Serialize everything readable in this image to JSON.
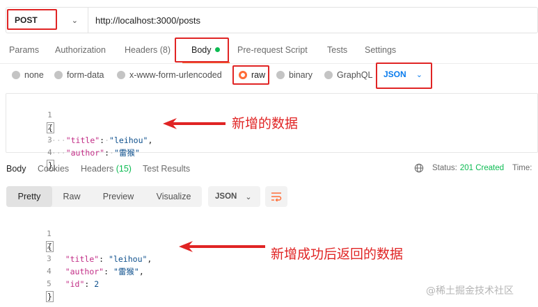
{
  "request": {
    "method": "POST",
    "url": "http://localhost:3000/posts",
    "tabs": [
      {
        "label": "Params"
      },
      {
        "label": "Authorization"
      },
      {
        "label": "Headers (8)"
      },
      {
        "label": "Body"
      },
      {
        "label": "Pre-request Script"
      },
      {
        "label": "Tests"
      },
      {
        "label": "Settings"
      }
    ],
    "active_tab": "Body",
    "body_types": [
      {
        "label": "none"
      },
      {
        "label": "form-data"
      },
      {
        "label": "x-www-form-urlencoded"
      },
      {
        "label": "raw"
      },
      {
        "label": "binary"
      },
      {
        "label": "GraphQL"
      }
    ],
    "selected_body_type": "raw",
    "format": "JSON",
    "body_lines": [
      {
        "num": "1",
        "text": "{"
      },
      {
        "num": "2",
        "key": "\"title\"",
        "value": "\"leihou\""
      },
      {
        "num": "3",
        "key": "\"author\"",
        "value": "\"雷猴\""
      },
      {
        "num": "4",
        "text": "}"
      }
    ]
  },
  "response": {
    "tabs": [
      {
        "label": "Body"
      },
      {
        "label": "Cookies"
      },
      {
        "label": "Headers",
        "count": "(15)"
      },
      {
        "label": "Test Results"
      }
    ],
    "status_label": "Status:",
    "status_value": "201 Created",
    "time_label": "Time:",
    "views": [
      "Pretty",
      "Raw",
      "Preview",
      "Visualize"
    ],
    "active_view": "Pretty",
    "format": "JSON",
    "body_lines": [
      {
        "num": "1",
        "text": "{"
      },
      {
        "num": "2",
        "key": "\"title\"",
        "value": "\"leihou\""
      },
      {
        "num": "3",
        "key": "\"author\"",
        "value": "\"雷猴\""
      },
      {
        "num": "4",
        "key": "\"id\"",
        "value": "2"
      },
      {
        "num": "5",
        "text": "}"
      }
    ]
  },
  "annotations": {
    "request_note": "新增的数据",
    "response_note": "新增成功后返回的数据"
  },
  "watermark": "@稀土掘金技术社区",
  "colors": {
    "accent": "#ff6c37",
    "highlight": "#e02424",
    "success": "#0cbb52",
    "link": "#097bed"
  }
}
